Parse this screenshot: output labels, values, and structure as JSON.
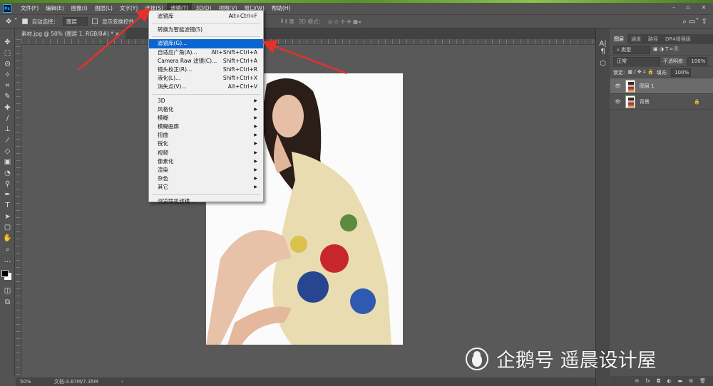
{
  "app": {
    "logo": "Ps",
    "window_controls": [
      "minimize-icon",
      "maximize-icon",
      "close-icon"
    ]
  },
  "menubar": [
    "文件(F)",
    "编辑(E)",
    "图像(I)",
    "图层(L)",
    "文字(Y)",
    "选择(S)",
    "滤镜(T)",
    "3D(D)",
    "视图(V)",
    "窗口(W)",
    "帮助(H)"
  ],
  "options": {
    "auto_select_label": "自动选择：",
    "auto_select_value": "图层",
    "show_transform_label": "显示变换控件",
    "mode_3d_label": "3D 模式："
  },
  "document_tab": {
    "title": "素材.jpg @ 50% (图层 1, RGB/8#) *",
    "close": "×"
  },
  "tools": [
    "✥",
    "⬚",
    "ʘ",
    "✧",
    "⌗",
    "✎",
    "✚",
    "∕",
    "⊥",
    "⁄",
    "◇",
    "▣",
    "◔",
    "⚲",
    "✒",
    "T",
    "➤",
    "▢",
    "✋",
    "⌕",
    "…"
  ],
  "filter_menu": {
    "top": [
      {
        "label": "滤镜库",
        "shortcut": "Alt+Ctrl+F"
      }
    ],
    "smart": [
      {
        "label": "转换为智能滤镜(S)",
        "shortcut": ""
      }
    ],
    "main": [
      {
        "label": "滤镜库(G)...",
        "shortcut": "",
        "highlighted": true
      },
      {
        "label": "自适应广角(A)...",
        "shortcut": "Alt+Shift+Ctrl+A"
      },
      {
        "label": "Camera Raw 滤镜(C)...",
        "shortcut": "Shift+Ctrl+A"
      },
      {
        "label": "镜头校正(R)...",
        "shortcut": "Shift+Ctrl+R"
      },
      {
        "label": "液化(L)...",
        "shortcut": "Shift+Ctrl+X"
      },
      {
        "label": "消失点(V)...",
        "shortcut": "Alt+Ctrl+V"
      }
    ],
    "submenus": [
      "3D",
      "风格化",
      "模糊",
      "模糊画廊",
      "扭曲",
      "锐化",
      "视频",
      "像素化",
      "渲染",
      "杂色",
      "其它"
    ],
    "bottom": [
      {
        "label": "浏览联机滤镜...",
        "shortcut": ""
      }
    ]
  },
  "status": {
    "zoom": "50%",
    "doc": "文档:3.67M/7.35M",
    "arrow": "›"
  },
  "layers_panel": {
    "tabs": [
      "图层",
      "通道",
      "路径",
      "DR4增强版"
    ],
    "kind_filter": "类型",
    "blend_mode": "正常",
    "opacity_label": "不透明度:",
    "opacity_value": "100%",
    "lock_label": "锁定:",
    "fill_label": "填充:",
    "fill_value": "100%",
    "layers": [
      {
        "name": "图层 1",
        "selected": true,
        "locked": false
      },
      {
        "name": "背景",
        "selected": false,
        "locked": true
      }
    ],
    "bottom_icons": [
      "link-icon",
      "fx-icon",
      "mask-icon",
      "adjustment-icon",
      "folder-icon",
      "new-layer-icon",
      "trash-icon"
    ],
    "bottom_glyphs": [
      "⊖",
      "fx",
      "◘",
      "◐",
      "▬",
      "⊞",
      "🗑"
    ]
  },
  "watermark": "企鹅号 遥晨设计屋",
  "colors": {
    "accent": "#0a64d2",
    "arrow": "#e8302a"
  }
}
